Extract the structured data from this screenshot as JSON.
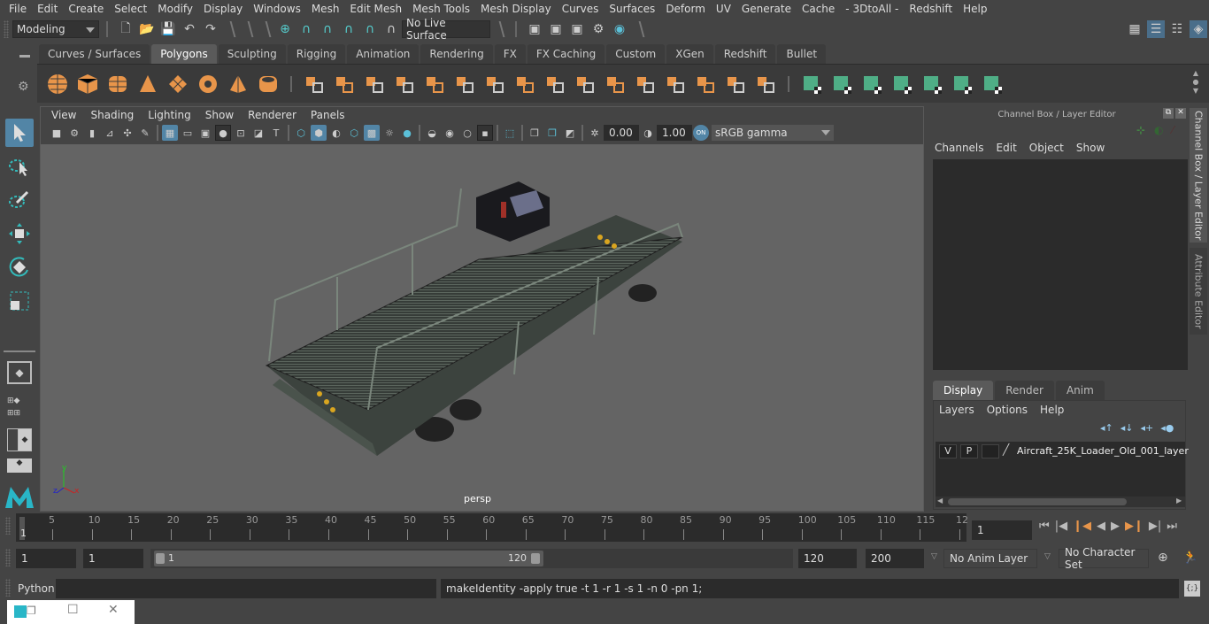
{
  "menubar": {
    "items": [
      "File",
      "Edit",
      "Create",
      "Select",
      "Modify",
      "Display",
      "Windows",
      "Mesh",
      "Edit Mesh",
      "Mesh Tools",
      "Mesh Display",
      "Curves",
      "Surfaces",
      "Deform",
      "UV",
      "Generate",
      "Cache",
      "- 3DtoAll -",
      "Redshift",
      "Help"
    ]
  },
  "statusline": {
    "workspace": "Modeling",
    "live_surface": "No Live Surface"
  },
  "shelf": {
    "tabs": [
      "Curves / Surfaces",
      "Polygons",
      "Sculpting",
      "Rigging",
      "Animation",
      "Rendering",
      "FX",
      "FX Caching",
      "Custom",
      "XGen",
      "Redshift",
      "Bullet"
    ],
    "active_tab": "Polygons",
    "icons": [
      "poly-sphere",
      "poly-cube",
      "poly-cylinder",
      "poly-cone",
      "poly-plane",
      "poly-torus",
      "poly-pyramid",
      "poly-pipe",
      "combine",
      "separate",
      "mirror",
      "smooth",
      "bevel",
      "multi-cut",
      "extrude",
      "bridge",
      "append",
      "fill-hole",
      "edge-loop",
      "insert-edge-loop",
      "triangulate",
      "quadrangulate",
      "target-weld",
      "merge",
      "planar-uv",
      "cylindrical-uv",
      "spherical-uv",
      "automatic-uv",
      "unfold-uv",
      "uv-editor",
      "layout-uv"
    ],
    "accent_orange": "#e8954a",
    "accent_green": "#4fae86"
  },
  "viewport": {
    "menu": [
      "View",
      "Shading",
      "Lighting",
      "Show",
      "Renderer",
      "Panels"
    ],
    "exposure": "0.00",
    "gamma": "1.00",
    "color_management": "ON",
    "color_space": "sRGB gamma",
    "camera_label": "persp",
    "axis": {
      "x": "x",
      "y": "y",
      "z": "z"
    }
  },
  "channel_box": {
    "title": "Channel Box / Layer Editor",
    "menu": [
      "Channels",
      "Edit",
      "Object",
      "Show"
    ]
  },
  "layer_editor": {
    "tabs": [
      "Display",
      "Render",
      "Anim"
    ],
    "active_tab": "Display",
    "menu": [
      "Layers",
      "Options",
      "Help"
    ],
    "layers": [
      {
        "visible": "V",
        "playback": "P",
        "name": "Aircraft_25K_Loader_Old_001_layer"
      }
    ]
  },
  "side_tabs": [
    "Channel Box / Layer Editor",
    "Attribute Editor"
  ],
  "timeline": {
    "ticks": [
      5,
      10,
      15,
      20,
      25,
      30,
      35,
      40,
      45,
      50,
      55,
      60,
      65,
      70,
      75,
      80,
      85,
      90,
      95,
      100,
      105,
      110,
      115,
      "12"
    ],
    "current_frame_marker": "1",
    "current_frame": "1"
  },
  "range": {
    "start": "1",
    "playback_start": "1",
    "slider_start": "1",
    "slider_end": "120",
    "playback_end": "120",
    "end": "200",
    "anim_layer": "No Anim Layer",
    "character_set": "No Character Set"
  },
  "command_line": {
    "language": "Python",
    "input": "",
    "result": "makeIdentity -apply true -t 1 -r 1 -s 1 -n 0 -pn 1;"
  }
}
